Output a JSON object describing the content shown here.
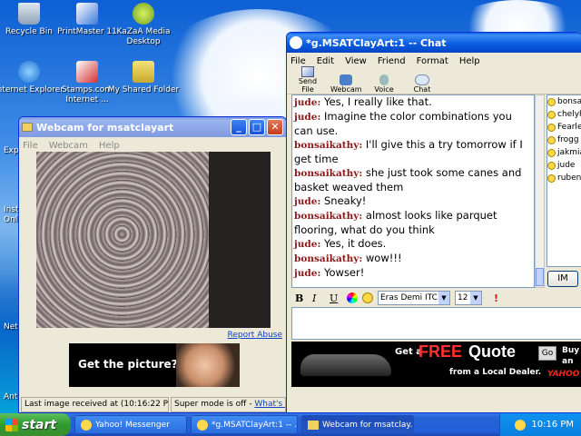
{
  "desktop": {
    "icons": [
      {
        "label": "Recycle Bin",
        "icon": "recycle-bin-icon"
      },
      {
        "label": "PrintMaster 11",
        "icon": "printmaster-icon"
      },
      {
        "label": "KaZaA Media Desktop",
        "icon": "kazaa-icon"
      },
      {
        "label": "Internet Explorer",
        "icon": "internet-explorer-icon"
      },
      {
        "label": "Stamps.com Internet ...",
        "icon": "stamps-icon"
      },
      {
        "label": "My Shared Folder",
        "icon": "shared-folder-icon"
      }
    ],
    "side_labels": [
      "Exp",
      "Inst Onli",
      "Net",
      "Anti"
    ]
  },
  "webcam": {
    "title": "Webcam for msatclayart",
    "menu": [
      "File",
      "Webcam",
      "Help"
    ],
    "report_abuse": "Report Abuse",
    "ad_text": "Get the picture?",
    "status_left": "Last image received at (10:16:22 PM)",
    "status_right_prefix": "Super mode is off - ",
    "status_right_link": "What's this?"
  },
  "chat": {
    "title": "*g.MSATClayArt:1 -- Chat",
    "menu": [
      "File",
      "Edit",
      "View",
      "Friend",
      "Format",
      "Help"
    ],
    "toolbar": [
      {
        "label": "Send File",
        "icon": "send-file-icon"
      },
      {
        "label": "Webcam",
        "icon": "webcam-icon"
      },
      {
        "label": "Voice",
        "icon": "voice-icon"
      },
      {
        "label": "Chat",
        "icon": "chat-icon"
      }
    ],
    "messages": [
      {
        "nick": "jude:",
        "text": "Yes, I really like that."
      },
      {
        "nick": "jude:",
        "text": "Imagine the color combinations you can use."
      },
      {
        "nick": "bonsaikathy:",
        "text": "I'll give this a try tomorrow if I get time"
      },
      {
        "nick": "bonsaikathy:",
        "text": "she just took some canes and basket weaved them"
      },
      {
        "nick": "jude:",
        "text": "Sneaky!"
      },
      {
        "nick": "bonsaikathy:",
        "text": "almost looks like parquet flooring, what do you think"
      },
      {
        "nick": "jude:",
        "text": "Yes, it does."
      },
      {
        "nick": "bonsaikathy:",
        "text": "wow!!!"
      },
      {
        "nick": "jude:",
        "text": "Yowser!"
      }
    ],
    "users": [
      "bonsa",
      "chelyh",
      "Fearle",
      "frogg",
      "jakmia",
      "jude",
      "rubens"
    ],
    "im_button": "IM",
    "format": {
      "bold": "B",
      "italic": "I",
      "underline": "U",
      "font": "Eras Demi ITC",
      "size": "12"
    },
    "input_value": "",
    "ad": {
      "get_a": "Get a",
      "free": "FREE",
      "quote": "Quote",
      "go": "Go",
      "dealer": "from a Local Dealer.",
      "buy": "Buy",
      "an": "an",
      "yahoo": "YAHOO"
    }
  },
  "taskbar": {
    "start": "start",
    "tasks": [
      {
        "label": "Yahoo! Messenger",
        "icon": "yahoo-messenger-icon"
      },
      {
        "label": "*g.MSATClayArt:1 -- ...",
        "icon": "chat-window-icon"
      },
      {
        "label": "Webcam for msatclay...",
        "icon": "webcam-window-icon"
      }
    ],
    "clock": "10:16 PM"
  }
}
